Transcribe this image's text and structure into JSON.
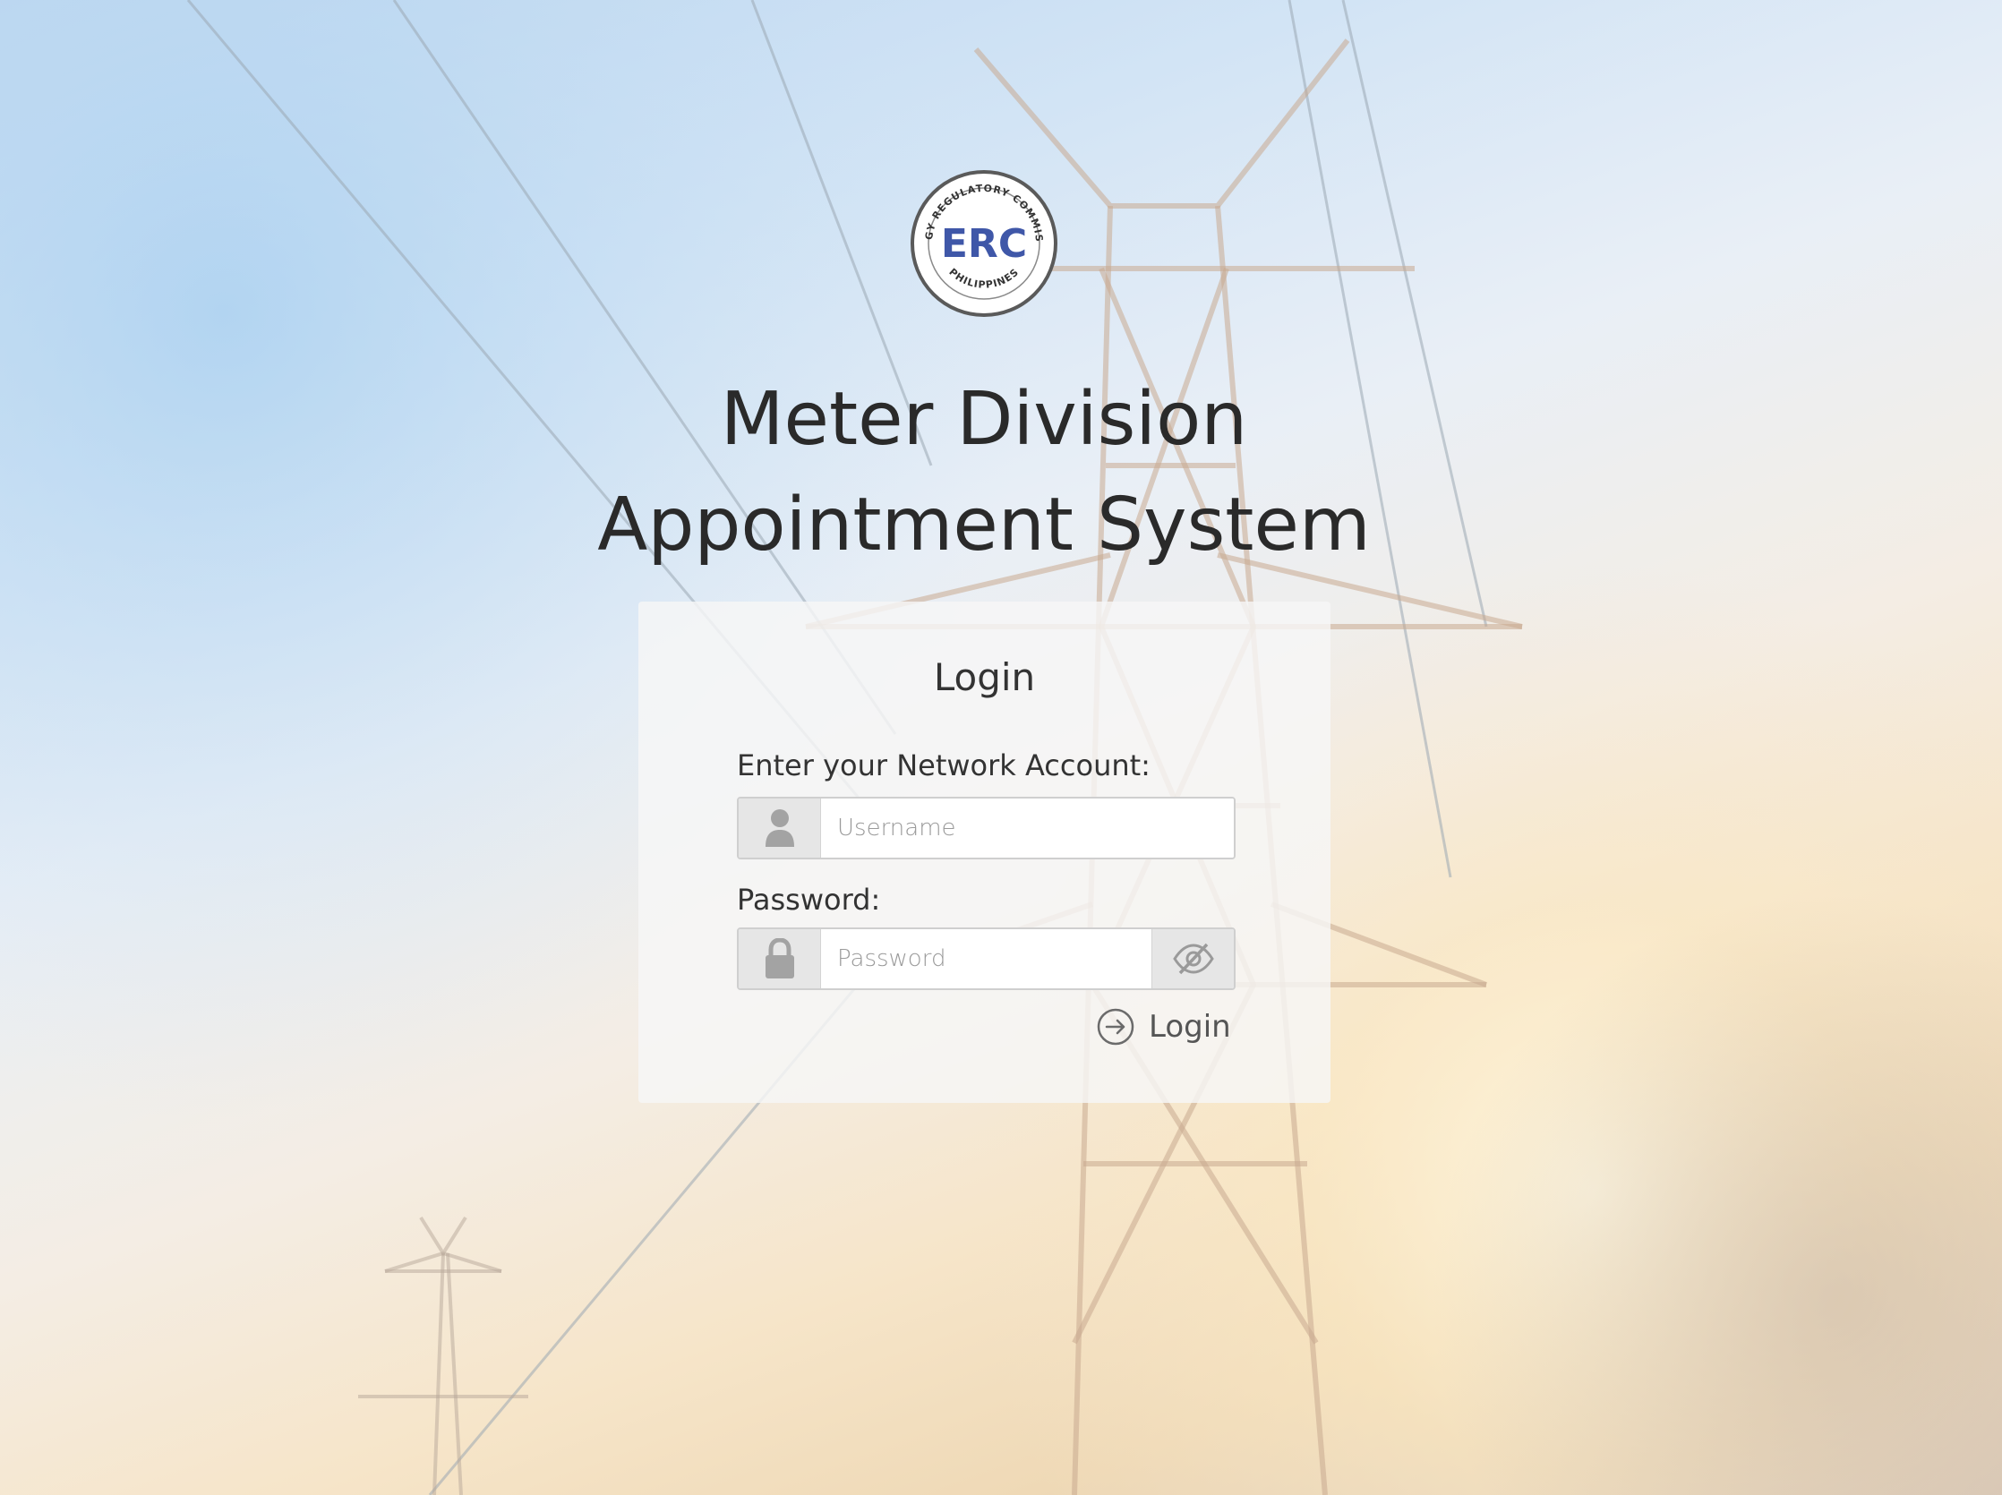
{
  "logo": {
    "text": "ERC",
    "ring_text": "ENERGY REGULATORY COMMISSION",
    "bottom_text": "PHILIPPINES",
    "color": "#3f57a8"
  },
  "title": {
    "line1": "Meter Division",
    "line2": "Appointment System"
  },
  "login_card": {
    "heading": "Login",
    "username_label": "Enter your Network Account:",
    "username_placeholder": "Username",
    "password_label": "Password:",
    "password_placeholder": "Password",
    "submit_label": "Login"
  },
  "icons": {
    "user": "user-icon",
    "lock": "lock-icon",
    "toggle_password": "eye-slash-icon",
    "submit": "arrow-right-circle-icon"
  }
}
